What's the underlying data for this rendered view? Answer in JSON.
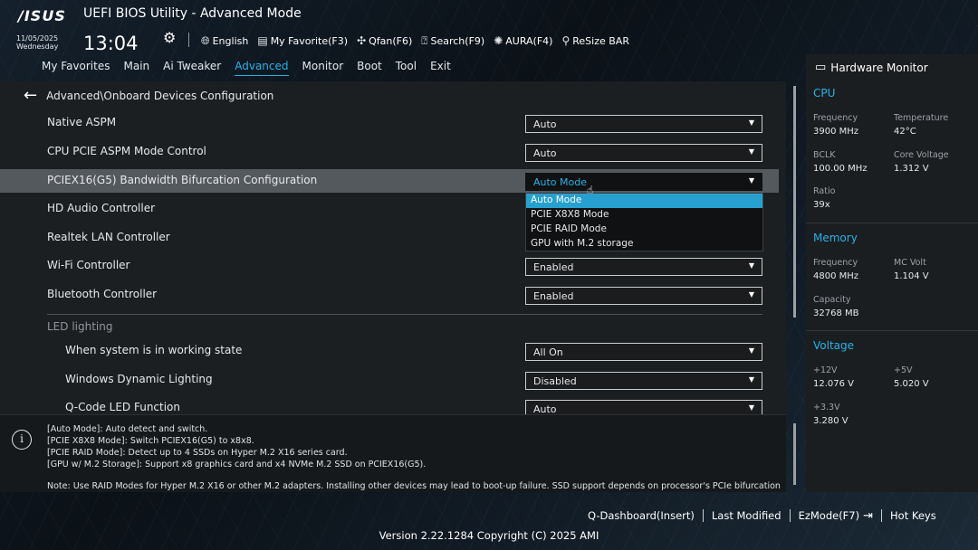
{
  "header": {
    "logo": "/ISUS",
    "title": "UEFI BIOS Utility - Advanced Mode",
    "date": "11/05/2025",
    "weekday": "Wednesday",
    "time": "13:04",
    "toolbar": [
      {
        "icon": "globe-icon",
        "label": "English"
      },
      {
        "icon": "favorite-icon",
        "label": "My Favorite(F3)"
      },
      {
        "icon": "fan-icon",
        "label": "Qfan(F6)"
      },
      {
        "icon": "search-icon",
        "label": "Search(F9)"
      },
      {
        "icon": "aura-icon",
        "label": "AURA(F4)"
      },
      {
        "icon": "resize-bar-icon",
        "label": "ReSize BAR"
      }
    ]
  },
  "tabs": [
    "My Favorites",
    "Main",
    "Ai Tweaker",
    "Advanced",
    "Monitor",
    "Boot",
    "Tool",
    "Exit"
  ],
  "active_tab": "Advanced",
  "main": {
    "breadcrumb": "Advanced\\Onboard Devices Configuration",
    "rows": [
      {
        "label": "Native ASPM",
        "value": "Auto"
      },
      {
        "label": "CPU PCIE ASPM Mode Control",
        "value": "Auto"
      },
      {
        "label": "PCIEX16(G5) Bandwidth Bifurcation Configuration",
        "value": "Auto Mode"
      },
      {
        "label": "HD Audio Controller"
      },
      {
        "label": "Realtek LAN Controller"
      },
      {
        "label": "Wi-Fi Controller",
        "value": "Enabled"
      },
      {
        "label": "Bluetooth Controller",
        "value": "Enabled"
      }
    ],
    "dropdown_options": [
      "Auto Mode",
      "PCIE X8X8 Mode",
      "PCIE RAID Mode",
      "GPU with M.2 storage"
    ],
    "selected_option": "Auto Mode",
    "led_section": "LED lighting",
    "led_rows": [
      {
        "label": "When system is in working state",
        "value": "All On"
      },
      {
        "label": "Windows Dynamic Lighting",
        "value": "Disabled"
      },
      {
        "label": "Q-Code LED Function",
        "value": "Auto"
      }
    ]
  },
  "help": {
    "lines": [
      "[Auto Mode]: Auto detect and switch.",
      "[PCIE X8X8 Mode]: Switch PCIEX16(G5) to x8x8.",
      "[PCIE RAID Mode]: Detect up to 4 SSDs on Hyper M.2 X16 series card.",
      "[GPU w/ M.2 Storage]: Support x8 graphics card and x4 NVMe M.2 SSD on PCIEX16(G5)."
    ],
    "note": "Note: Use RAID Modes for Hyper M.2 X16 or other M.2 adapters. Installing other devices may lead to boot-up failure. SSD support depends on processor's PCIe bifurcation"
  },
  "hw": {
    "title": "Hardware Monitor",
    "cpu": {
      "title": "CPU",
      "frequency_label": "Frequency",
      "frequency": "3900 MHz",
      "temperature_label": "Temperature",
      "temperature": "42°C",
      "bclk_label": "BCLK",
      "bclk": "100.00 MHz",
      "core_voltage_label": "Core Voltage",
      "core_voltage": "1.312 V",
      "ratio_label": "Ratio",
      "ratio": "39x"
    },
    "memory": {
      "title": "Memory",
      "frequency_label": "Frequency",
      "frequency": "4800 MHz",
      "mc_volt_label": "MC Volt",
      "mc_volt": "1.104 V",
      "capacity_label": "Capacity",
      "capacity": "32768 MB"
    },
    "voltage": {
      "title": "Voltage",
      "v12_label": "+12V",
      "v12": "12.076 V",
      "v5_label": "+5V",
      "v5": "5.020 V",
      "v33_label": "+3.3V",
      "v33": "3.280 V"
    }
  },
  "footer": {
    "qdashboard": "Q-Dashboard(Insert)",
    "last_modified": "Last Modified",
    "ezmode": "EzMode(F7)",
    "hotkeys": "Hot Keys",
    "version": "Version 2.22.1284 Copyright (C) 2025 AMI"
  },
  "colors": {
    "accent": "#27b3e6",
    "highlight_row": "#54595e",
    "selected_option": "#27a0d0"
  }
}
